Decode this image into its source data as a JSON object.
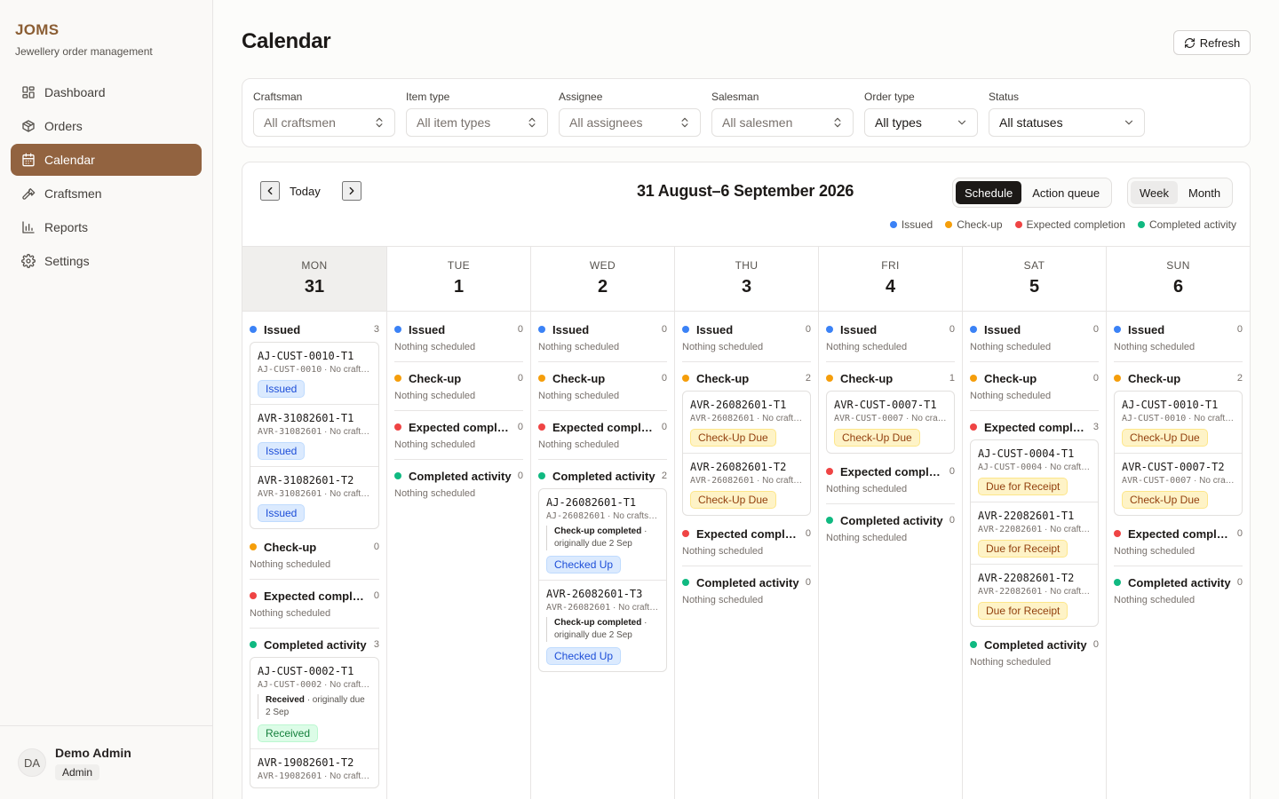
{
  "brand": {
    "name": "JOMS",
    "subtitle": "Jewellery order management"
  },
  "nav": [
    {
      "label": "Dashboard",
      "icon": "dashboard-icon"
    },
    {
      "label": "Orders",
      "icon": "package-icon"
    },
    {
      "label": "Calendar",
      "icon": "calendar-icon",
      "active": true
    },
    {
      "label": "Craftsmen",
      "icon": "hammer-icon"
    },
    {
      "label": "Reports",
      "icon": "bar-chart-icon"
    },
    {
      "label": "Settings",
      "icon": "gear-icon"
    }
  ],
  "user": {
    "initials": "DA",
    "name": "Demo Admin",
    "role": "Admin"
  },
  "page": {
    "title": "Calendar",
    "refresh_label": "Refresh"
  },
  "filters": [
    {
      "label": "Craftsman",
      "value": "All craftsmen",
      "icon": "chevrons-up-down-icon"
    },
    {
      "label": "Item type",
      "value": "All item types",
      "icon": "chevrons-up-down-icon"
    },
    {
      "label": "Assignee",
      "value": "All assignees",
      "icon": "chevrons-up-down-icon"
    },
    {
      "label": "Salesman",
      "value": "All salesmen",
      "icon": "chevrons-up-down-icon"
    },
    {
      "label": "Order type",
      "value": "All types",
      "icon": "chevron-down-icon"
    },
    {
      "label": "Status",
      "value": "All statuses",
      "icon": "chevron-down-icon"
    }
  ],
  "calendar": {
    "today_label": "Today",
    "range": "31 August–6 September 2026",
    "view_tabs": [
      "Schedule",
      "Action queue"
    ],
    "active_view": "Schedule",
    "period_tabs": [
      "Week",
      "Month"
    ],
    "active_period": "Week",
    "legend": [
      {
        "label": "Issued",
        "color": "#3b82f6"
      },
      {
        "label": "Check-up",
        "color": "#f59e0b"
      },
      {
        "label": "Expected completion",
        "color": "#ef4444"
      },
      {
        "label": "Completed activity",
        "color": "#10b981"
      }
    ],
    "empty_text": "Nothing scheduled",
    "days": [
      {
        "dow": "MON",
        "num": "31",
        "current": true,
        "sections": [
          {
            "name": "Issued",
            "count": "3",
            "items": [
              {
                "id": "AJ-CUST-0010-T1",
                "order": "AJ-CUST-0010",
                "sub": "No crafts…",
                "badge": "Issued",
                "kind": "issued"
              },
              {
                "id": "AVR-31082601-T1",
                "order": "AVR-31082601",
                "sub": "No crafts…",
                "badge": "Issued",
                "kind": "issued"
              },
              {
                "id": "AVR-31082601-T2",
                "order": "AVR-31082601",
                "sub": "No crafts…",
                "badge": "Issued",
                "kind": "issued"
              }
            ]
          },
          {
            "name": "Check-up",
            "count": "0",
            "items": []
          },
          {
            "name": "Expected completi…",
            "count": "0",
            "items": []
          },
          {
            "name": "Completed activity",
            "count": "3",
            "items": [
              {
                "id": "AJ-CUST-0002-T1",
                "order": "AJ-CUST-0002",
                "sub": "No crafts…",
                "note_b": "Received",
                "note": "· originally due 2 Sep",
                "badge": "Received",
                "kind": "received"
              },
              {
                "id": "AVR-19082601-T2",
                "order": "AVR-19082601",
                "sub": "No crafts…",
                "badge": "",
                "kind": "received"
              }
            ]
          }
        ]
      },
      {
        "dow": "TUE",
        "num": "1",
        "sections": [
          {
            "name": "Issued",
            "count": "0",
            "items": []
          },
          {
            "name": "Check-up",
            "count": "0",
            "items": []
          },
          {
            "name": "Expected completi…",
            "count": "0",
            "items": []
          },
          {
            "name": "Completed activity",
            "count": "0",
            "items": []
          }
        ]
      },
      {
        "dow": "WED",
        "num": "2",
        "sections": [
          {
            "name": "Issued",
            "count": "0",
            "items": []
          },
          {
            "name": "Check-up",
            "count": "0",
            "items": []
          },
          {
            "name": "Expected completi…",
            "count": "0",
            "items": []
          },
          {
            "name": "Completed activity",
            "count": "2",
            "items": [
              {
                "id": "AJ-26082601-T1",
                "order": "AJ-26082601",
                "sub": "No craftsm…",
                "note_b": "Check-up completed",
                "note": "· originally due 2 Sep",
                "badge": "Checked Up",
                "kind": "checked"
              },
              {
                "id": "AVR-26082601-T3",
                "order": "AVR-26082601",
                "sub": "No crafts…",
                "note_b": "Check-up completed",
                "note": "· originally due 2 Sep",
                "badge": "Checked Up",
                "kind": "checked"
              }
            ]
          }
        ]
      },
      {
        "dow": "THU",
        "num": "3",
        "sections": [
          {
            "name": "Issued",
            "count": "0",
            "items": []
          },
          {
            "name": "Check-up",
            "count": "2",
            "items": [
              {
                "id": "AVR-26082601-T1",
                "order": "AVR-26082601",
                "sub": "No crafts…",
                "badge": "Check-Up Due",
                "kind": "checkup"
              },
              {
                "id": "AVR-26082601-T2",
                "order": "AVR-26082601",
                "sub": "No crafts…",
                "badge": "Check-Up Due",
                "kind": "checkup"
              }
            ]
          },
          {
            "name": "Expected completi…",
            "count": "0",
            "items": []
          },
          {
            "name": "Completed activity",
            "count": "0",
            "items": []
          }
        ]
      },
      {
        "dow": "FRI",
        "num": "4",
        "sections": [
          {
            "name": "Issued",
            "count": "0",
            "items": []
          },
          {
            "name": "Check-up",
            "count": "1",
            "items": [
              {
                "id": "AVR-CUST-0007-T1",
                "order": "AVR-CUST-0007",
                "sub": "No craft…",
                "badge": "Check-Up Due",
                "kind": "checkup"
              }
            ]
          },
          {
            "name": "Expected completi…",
            "count": "0",
            "items": []
          },
          {
            "name": "Completed activity",
            "count": "0",
            "items": []
          }
        ]
      },
      {
        "dow": "SAT",
        "num": "5",
        "sections": [
          {
            "name": "Issued",
            "count": "0",
            "items": []
          },
          {
            "name": "Check-up",
            "count": "0",
            "items": []
          },
          {
            "name": "Expected completi…",
            "count": "3",
            "items": [
              {
                "id": "AJ-CUST-0004-T1",
                "order": "AJ-CUST-0004",
                "sub": "No crafts…",
                "badge": "Due for Receipt",
                "kind": "due"
              },
              {
                "id": "AVR-22082601-T1",
                "order": "AVR-22082601",
                "sub": "No crafts…",
                "badge": "Due for Receipt",
                "kind": "due"
              },
              {
                "id": "AVR-22082601-T2",
                "order": "AVR-22082601",
                "sub": "No crafts…",
                "badge": "Due for Receipt",
                "kind": "due"
              }
            ]
          },
          {
            "name": "Completed activity",
            "count": "0",
            "items": []
          }
        ]
      },
      {
        "dow": "SUN",
        "num": "6",
        "sections": [
          {
            "name": "Issued",
            "count": "0",
            "items": []
          },
          {
            "name": "Check-up",
            "count": "2",
            "items": [
              {
                "id": "AJ-CUST-0010-T1",
                "order": "AJ-CUST-0010",
                "sub": "No crafts…",
                "badge": "Check-Up Due",
                "kind": "checkup"
              },
              {
                "id": "AVR-CUST-0007-T2",
                "order": "AVR-CUST-0007",
                "sub": "No craft…",
                "badge": "Check-Up Due",
                "kind": "checkup"
              }
            ]
          },
          {
            "name": "Expected completi…",
            "count": "0",
            "items": []
          },
          {
            "name": "Completed activity",
            "count": "0",
            "items": []
          }
        ]
      }
    ]
  }
}
